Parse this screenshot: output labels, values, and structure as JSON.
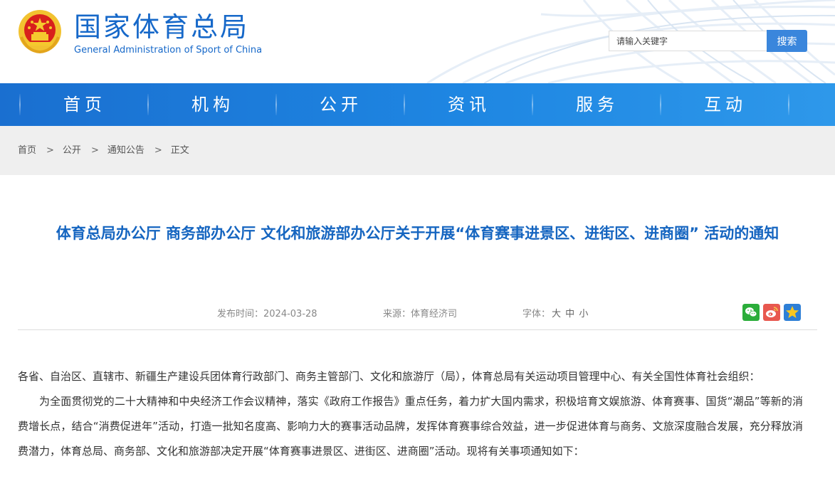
{
  "header": {
    "title_cn": "国家体育总局",
    "title_en": "General Administration of Sport of China",
    "search": {
      "placeholder": "请输入关键字",
      "button_label": "搜索"
    }
  },
  "nav": {
    "items": [
      {
        "label": "首页"
      },
      {
        "label": "机构"
      },
      {
        "label": "公开"
      },
      {
        "label": "资讯"
      },
      {
        "label": "服务"
      },
      {
        "label": "互动"
      }
    ]
  },
  "breadcrumb": {
    "items": [
      "首页",
      "公开",
      "通知公告",
      "正文"
    ],
    "separator": ">"
  },
  "article": {
    "title": "体育总局办公厅 商务部办公厅 文化和旅游部办公厅关于开展“体育赛事进景区、进街区、进商圈” 活动的通知",
    "publish_label": "发布时间：",
    "publish_date": "2024-03-28",
    "source_label": "来源：",
    "source": "体育经济司",
    "font_label": "字体：",
    "font_sizes": [
      "大",
      "中",
      "小"
    ],
    "share_icons": [
      "wechat-icon",
      "weibo-icon",
      "favorite-icon"
    ],
    "paragraphs": [
      "各省、自治区、直辖市、新疆生产建设兵团体育行政部门、商务主管部门、文化和旅游厅（局），体育总局有关运动项目管理中心、有关全国性体育社会组织：",
      "为全面贯彻党的二十大精神和中央经济工作会议精神，落实《政府工作报告》重点任务，着力扩大国内需求，积极培育文娱旅游、体育赛事、国货“潮品”等新的消费增长点，结合“消费促进年”活动，打造一批知名度高、影响力大的赛事活动品牌，发挥体育赛事综合效益，进一步促进体育与商务、文旅深度融合发展，充分释放消费潜力，体育总局、商务部、文化和旅游部决定开展“体育赛事进景区、进街区、进商圈”活动。现将有关事项通知如下："
    ]
  },
  "colors": {
    "brand_blue": "#1668c9",
    "nav_gradient_start": "#1a6fd0",
    "nav_gradient_end": "#2e98ea",
    "title_blue": "#1565c0",
    "search_button": "#3a86dc",
    "breadcrumb_bg": "#efefef"
  }
}
